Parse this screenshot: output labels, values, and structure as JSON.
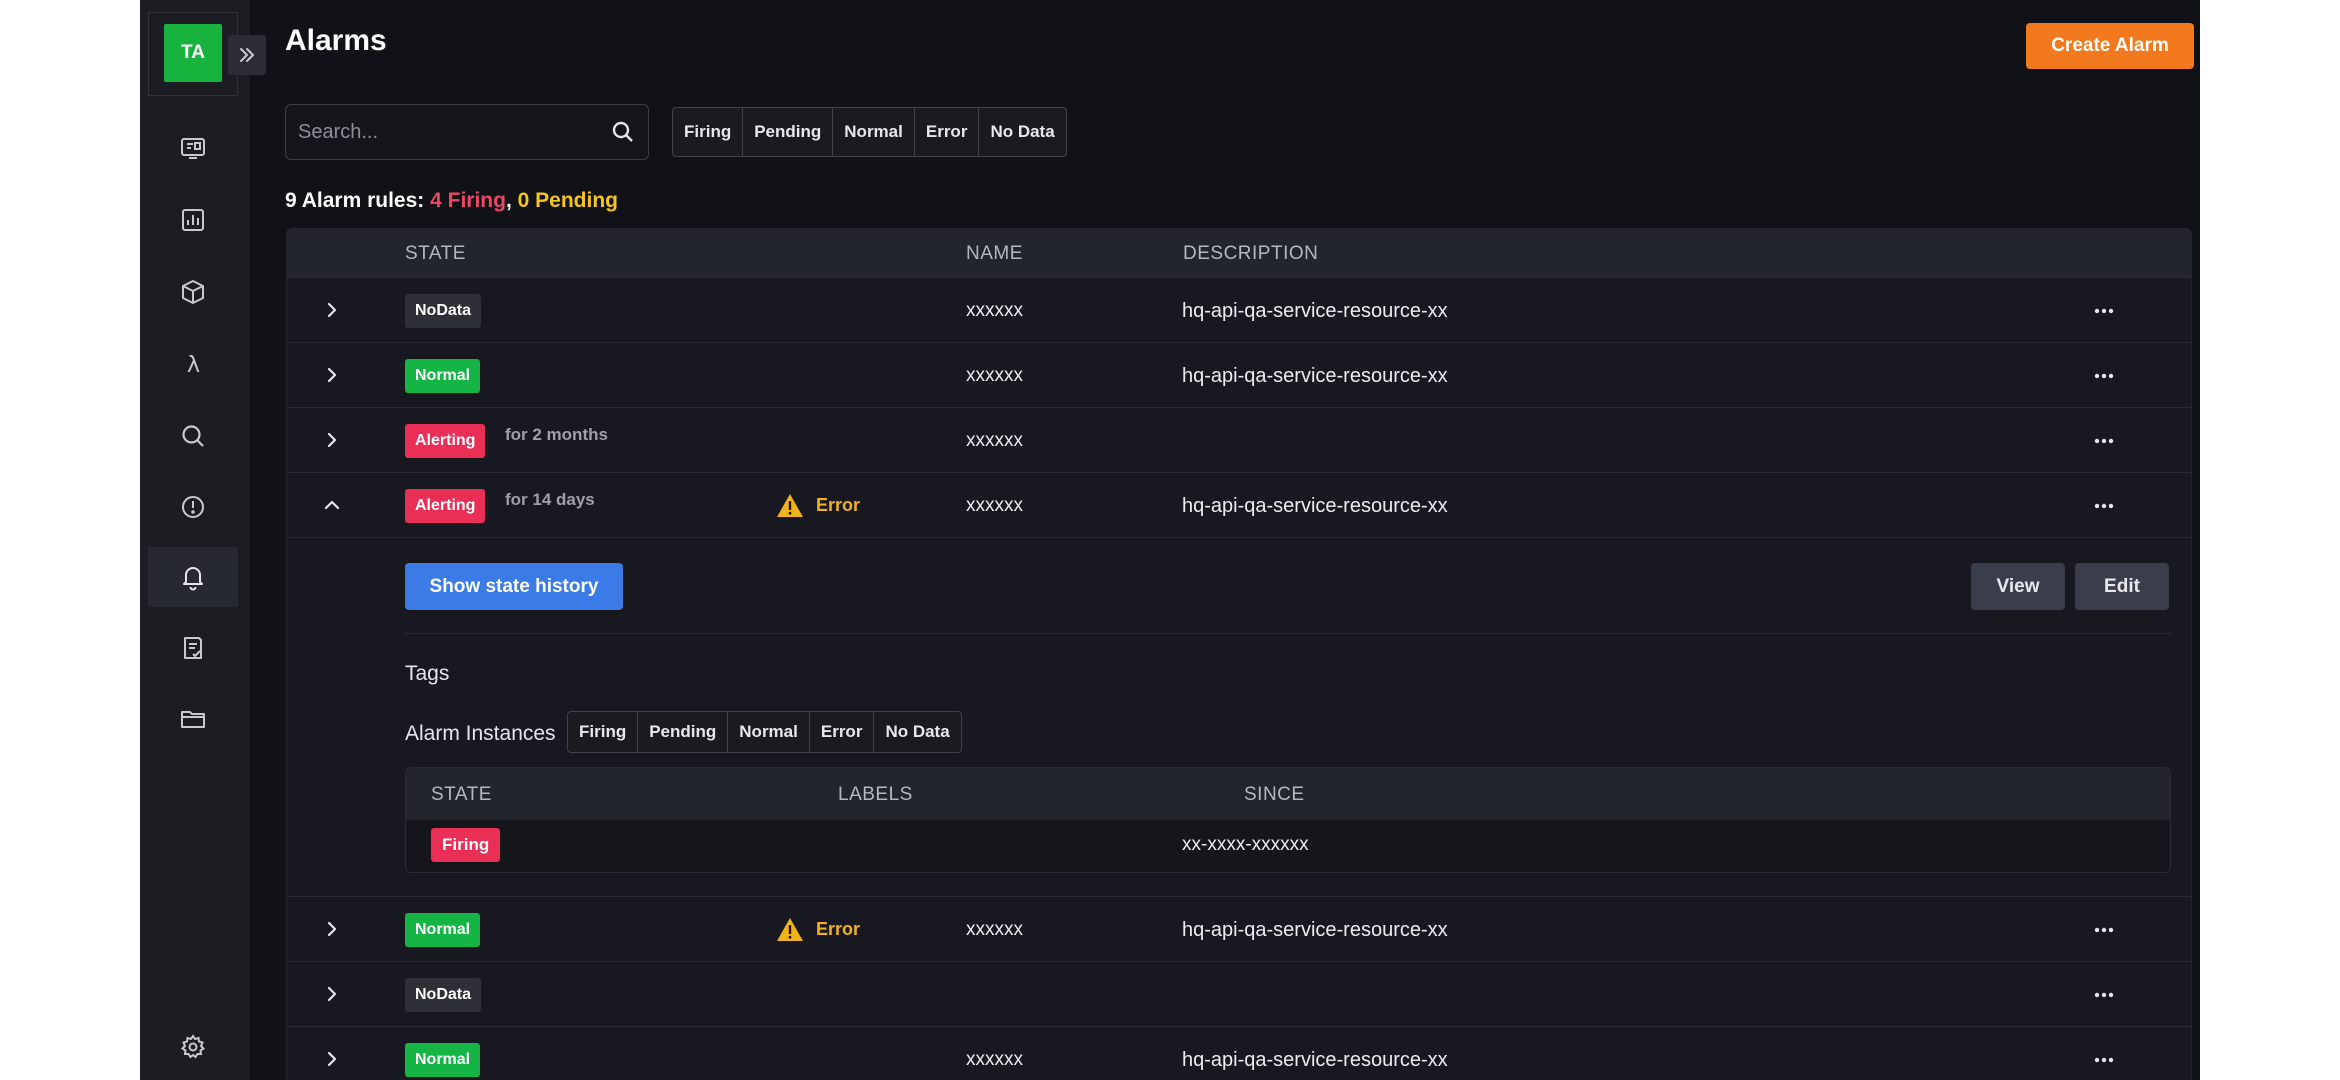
{
  "sidebar": {
    "avatar_initials": "TA",
    "items": [
      {
        "icon": "dashboard-icon"
      },
      {
        "icon": "chart-icon"
      },
      {
        "icon": "cube-icon"
      },
      {
        "icon": "lambda-icon"
      },
      {
        "icon": "search-icon"
      },
      {
        "icon": "alert-circle-icon"
      },
      {
        "icon": "bell-icon",
        "active": true
      },
      {
        "icon": "checklist-icon"
      },
      {
        "icon": "folder-icon"
      },
      {
        "icon": "gear-icon"
      }
    ]
  },
  "header": {
    "title": "Alarms",
    "create_button": "Create Alarm"
  },
  "search": {
    "placeholder": "Search..."
  },
  "state_filters": [
    "Firing",
    "Pending",
    "Normal",
    "Error",
    "No Data"
  ],
  "summary": {
    "prefix": "9 Alarm rules: ",
    "firing": "4 Firing",
    "separator": ", ",
    "pending": "0 Pending"
  },
  "table": {
    "columns": {
      "state": "STATE",
      "name": "NAME",
      "description": "DESCRIPTION"
    },
    "rows": [
      {
        "state": "NoData",
        "name": "xxxxxx",
        "description": "hq-api-qa-service-resource-xx"
      },
      {
        "state": "Normal",
        "name": "xxxxxx",
        "description": "hq-api-qa-service-resource-xx"
      },
      {
        "state": "Alerting",
        "since": "for 2 months",
        "name": "xxxxxx",
        "description": ""
      },
      {
        "state": "Alerting",
        "since": "for 14 days",
        "health": "Error",
        "name": "xxxxxx",
        "description": "hq-api-qa-service-resource-xx",
        "expanded": true
      },
      {
        "state": "Normal",
        "health": "Error",
        "name": "xxxxxx",
        "description": "hq-api-qa-service-resource-xx"
      },
      {
        "state": "NoData",
        "name": "",
        "description": ""
      },
      {
        "state": "Normal",
        "name": "xxxxxx",
        "description": "hq-api-qa-service-resource-xx"
      }
    ]
  },
  "details": {
    "history_button": "Show state history",
    "view_button": "View",
    "edit_button": "Edit",
    "tags_label": "Tags",
    "instances_label": "Alarm Instances",
    "instance_filters": [
      "Firing",
      "Pending",
      "Normal",
      "Error",
      "No Data"
    ],
    "instances_columns": {
      "state": "STATE",
      "labels": "LABELS",
      "since": "SINCE"
    },
    "instances": [
      {
        "state": "Firing",
        "labels": "",
        "since": "xx-xxxx-xxxxxx"
      }
    ]
  },
  "colors": {
    "accent": "#f2791d",
    "firing": "#f04665",
    "pending": "#f5c518",
    "normal": "#15b545",
    "primary_button": "#3a7be8"
  },
  "help_icon": "question-circle-icon"
}
